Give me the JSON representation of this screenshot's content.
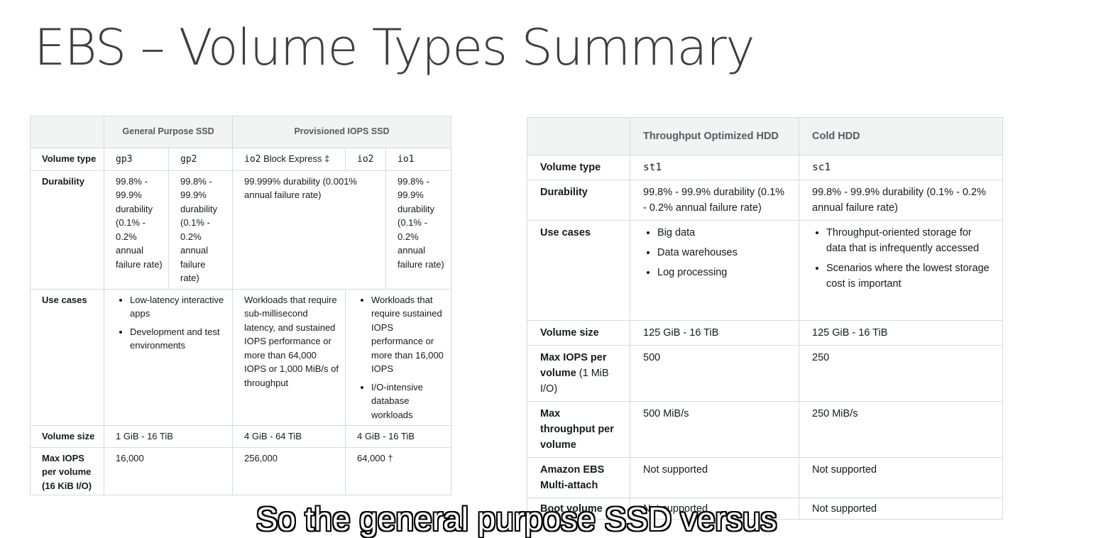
{
  "title": "EBS – Volume Types Summary",
  "left_table": {
    "group_ssd": "General Purpose SSD",
    "group_piops": "Provisioned IOPS SSD",
    "row_volume_type": {
      "label": "Volume type",
      "gp3": "gp3",
      "gp2": "gp2",
      "io2be": "io2",
      "io2be_suffix": " Block Express ‡",
      "io2": "io2",
      "io1": "io1"
    },
    "row_durability": {
      "label": "Durability",
      "gp3": "99.8% - 99.9% durability (0.1% - 0.2% annual failure rate)",
      "gp2": "99.8% - 99.9% durability (0.1% - 0.2% annual failure rate)",
      "io2": "99.999% durability (0.001% annual failure rate)",
      "io1": "99.8% - 99.9% durability (0.1% - 0.2% annual failure rate)"
    },
    "row_use_cases": {
      "label": "Use cases",
      "gp_items": [
        "Low-latency interactive apps",
        "Development and test environments"
      ],
      "io2be": "Workloads that require sub-millisecond latency, and sustained IOPS performance or more than 64,000 IOPS or 1,000 MiB/s of throughput",
      "io_items": [
        "Workloads that require sustained IOPS performance or more than 16,000 IOPS",
        "I/O-intensive database workloads"
      ]
    },
    "row_volume_size": {
      "label": "Volume size",
      "gp": "1 GiB - 16 TiB",
      "io2be": "4 GiB - 64 TiB",
      "io": "4 GiB - 16 TiB"
    },
    "row_max_iops": {
      "label": "Max IOPS per volume (16 KiB I/O)",
      "gp": "16,000",
      "io2be": "256,000",
      "io": "64,000 †"
    }
  },
  "right_table": {
    "head_st1": "Throughput Optimized HDD",
    "head_sc1": "Cold HDD",
    "row_volume_type": {
      "label": "Volume type",
      "st1": "st1",
      "sc1": "sc1"
    },
    "row_durability": {
      "label": "Durability",
      "st1": "99.8% - 99.9% durability (0.1% - 0.2% annual failure rate)",
      "sc1": "99.8% - 99.9% durability (0.1% - 0.2% annual failure rate)"
    },
    "row_use_cases": {
      "label": "Use cases",
      "st1_items": [
        "Big data",
        "Data warehouses",
        "Log processing"
      ],
      "sc1_items": [
        "Throughput-oriented storage for data that is infrequently accessed",
        "Scenarios where the lowest storage cost is important"
      ]
    },
    "row_volume_size": {
      "label": "Volume size",
      "st1": "125 GiB - 16 TiB",
      "sc1": "125 GiB - 16 TiB"
    },
    "row_max_iops": {
      "label_bold": "Max IOPS per volume",
      "label_rest": " (1 MiB I/O)",
      "st1": "500",
      "sc1": "250"
    },
    "row_max_throughput": {
      "label": "Max throughput per volume",
      "st1": "500 MiB/s",
      "sc1": "250 MiB/s"
    },
    "row_multi_attach": {
      "label": "Amazon EBS Multi-attach",
      "st1": "Not supported",
      "sc1": "Not supported"
    },
    "row_boot": {
      "label": "Boot volume",
      "st1": "Not supported",
      "sc1": "Not supported"
    }
  },
  "caption": "So the general purpose SSD versus"
}
